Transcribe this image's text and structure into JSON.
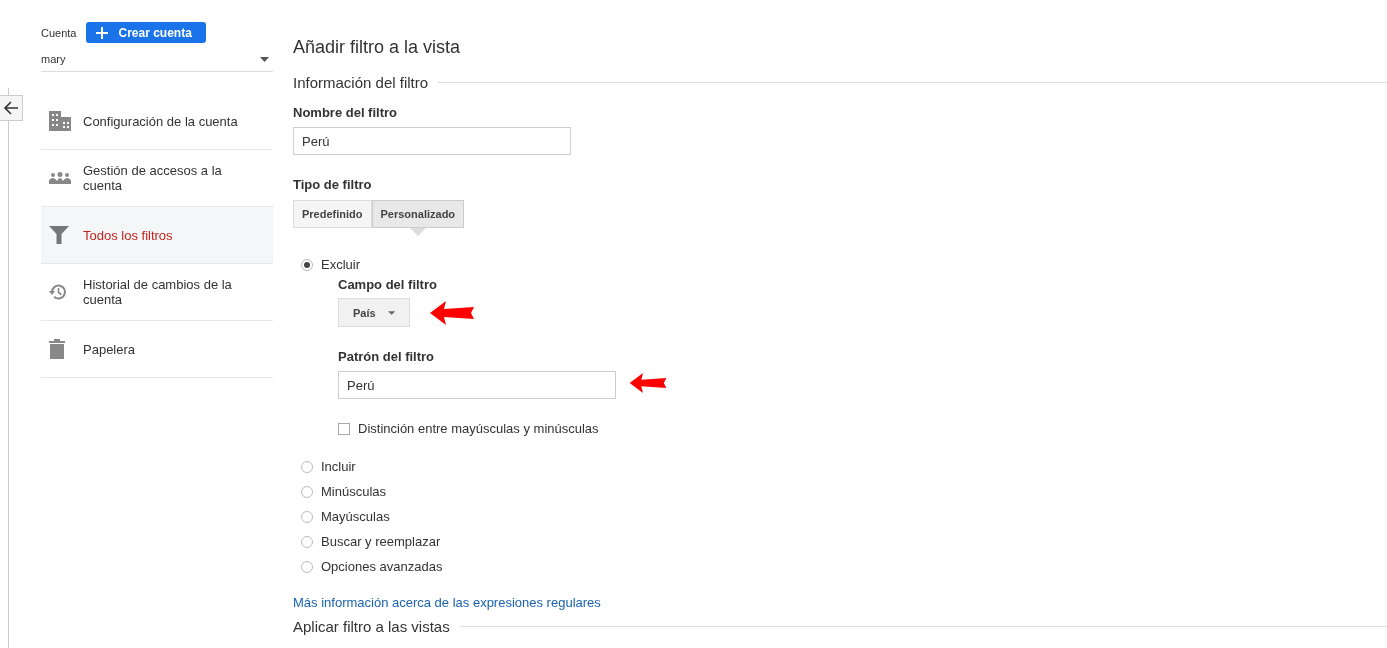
{
  "sidebar": {
    "account_label": "Cuenta",
    "create_button": "Crear cuenta",
    "account_select": "mary",
    "items": [
      {
        "label": "Configuración de la cuenta",
        "selected": false
      },
      {
        "label": "Gestión de accesos a la cuenta",
        "selected": false
      },
      {
        "label": "Todos los filtros",
        "selected": true
      },
      {
        "label": "Historial de cambios de la cuenta",
        "selected": false
      },
      {
        "label": "Papelera",
        "selected": false
      }
    ]
  },
  "title": "Añadir filtro a la vista",
  "section_info": "Información del filtro",
  "name_label": "Nombre del filtro",
  "name_value": "Perú",
  "type_label": "Tipo de filtro",
  "tabs": [
    {
      "label": "Predefinido",
      "selected": false
    },
    {
      "label": "Personalizado",
      "selected": true
    }
  ],
  "options": [
    {
      "label": "Excluir",
      "selected": true
    },
    {
      "label": "Incluir",
      "selected": false
    },
    {
      "label": "Minúsculas",
      "selected": false
    },
    {
      "label": "Mayúsculas",
      "selected": false
    },
    {
      "label": "Buscar y reemplazar",
      "selected": false
    },
    {
      "label": "Opciones avanzadas",
      "selected": false
    }
  ],
  "field_label": "Campo del filtro",
  "field_value": "País",
  "pattern_label": "Patrón del filtro",
  "pattern_value": "Perú",
  "case_label": "Distinción entre mayúsculas y minúsculas",
  "case_checked": false,
  "regex_link": "Más información acerca de las expresiones regulares",
  "section_apply": "Aplicar filtro a las vistas"
}
